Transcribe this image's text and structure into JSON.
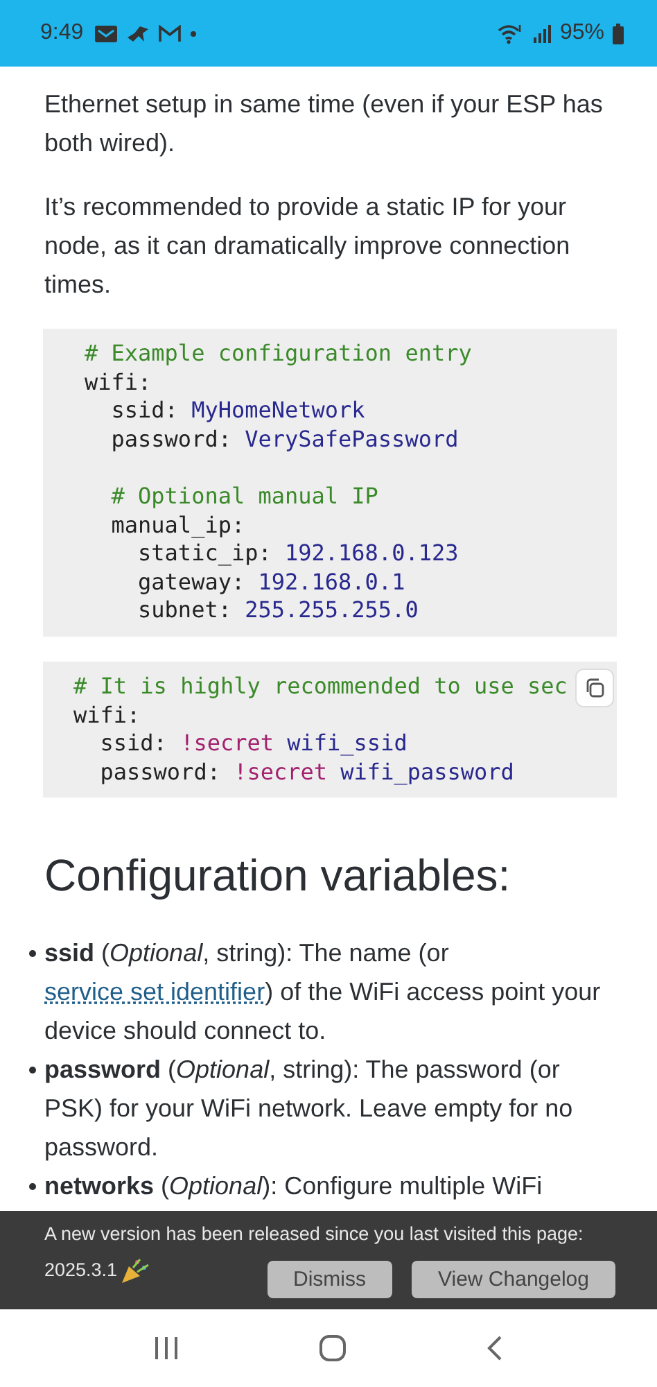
{
  "status_bar": {
    "time": "9:49",
    "battery": "95%"
  },
  "paragraphs": [
    "Ethernet setup in same time (even if your ESP has both wired).",
    "It’s recommended to provide a static IP for your node, as it can dramatically improve connection times."
  ],
  "code_blocks": [
    {
      "copy_button": false,
      "lines": [
        {
          "tokens": [
            {
              "kind": "comment",
              "text": "# Example configuration entry"
            }
          ]
        },
        {
          "tokens": [
            {
              "kind": "key",
              "text": "wifi:"
            }
          ]
        },
        {
          "tokens": [
            {
              "kind": "key",
              "text": "  ssid: "
            },
            {
              "kind": "value",
              "text": "MyHomeNetwork"
            }
          ]
        },
        {
          "tokens": [
            {
              "kind": "key",
              "text": "  password: "
            },
            {
              "kind": "value",
              "text": "VerySafePassword"
            }
          ]
        },
        {
          "kind": "blank"
        },
        {
          "tokens": [
            {
              "kind": "comment",
              "text": "  # Optional manual IP"
            }
          ]
        },
        {
          "tokens": [
            {
              "kind": "key",
              "text": "  manual_ip:"
            }
          ]
        },
        {
          "tokens": [
            {
              "kind": "key",
              "text": "    static_ip: "
            },
            {
              "kind": "value",
              "text": "192.168.0.123"
            }
          ]
        },
        {
          "tokens": [
            {
              "kind": "key",
              "text": "    gateway: "
            },
            {
              "kind": "value",
              "text": "192.168.0.1"
            }
          ]
        },
        {
          "tokens": [
            {
              "kind": "key",
              "text": "    subnet: "
            },
            {
              "kind": "value",
              "text": "255.255.255.0"
            }
          ]
        }
      ]
    },
    {
      "copy_button": true,
      "lines": [
        {
          "tokens": [
            {
              "kind": "comment",
              "text": "# It is highly recommended to use sec"
            }
          ]
        },
        {
          "tokens": [
            {
              "kind": "key",
              "text": "wifi:"
            }
          ]
        },
        {
          "tokens": [
            {
              "kind": "key",
              "text": "  ssid: "
            },
            {
              "kind": "tag",
              "text": "!secret"
            },
            {
              "kind": "value",
              "text": " wifi_ssid"
            }
          ]
        },
        {
          "tokens": [
            {
              "kind": "key",
              "text": "  password: "
            },
            {
              "kind": "tag",
              "text": "!secret"
            },
            {
              "kind": "value",
              "text": " wifi_password"
            }
          ]
        }
      ]
    }
  ],
  "heading": "Configuration variables:",
  "variables": [
    {
      "segments": [
        {
          "kind": "text",
          "text": "**ssid** (*Optional*, string): The name (or "
        },
        {
          "kind": "link",
          "text": "service set identifier"
        },
        {
          "kind": "text",
          "text": ") of the WiFi access point your device should connect to."
        }
      ]
    },
    {
      "segments": [
        {
          "kind": "text",
          "text": "**password** (*Optional*, string): The password (or PSK) for your WiFi network. Leave empty for no password."
        }
      ]
    },
    {
      "segments": [
        {
          "kind": "text",
          "text": "**networks** (*Optional*): Configure multiple WiFi"
        }
      ]
    }
  ],
  "banner": {
    "message": "A new version has been released since you last visited this page:",
    "version": "2025.3.1",
    "buttons": [
      "Dismiss",
      "View Changelog"
    ]
  }
}
